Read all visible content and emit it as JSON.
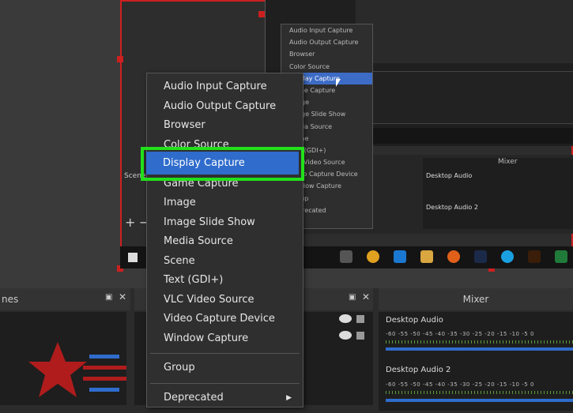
{
  "main_menu": {
    "items": [
      "Audio Input Capture",
      "Audio Output Capture",
      "Browser",
      "Color Source",
      "Display Capture",
      "Game Capture",
      "Image",
      "Image Slide Show",
      "Media Source",
      "Scene",
      "Text (GDI+)",
      "VLC Video Source",
      "Video Capture Device",
      "Window Capture"
    ],
    "group": "Group",
    "deprecated": "Deprecated"
  },
  "mini_menu": {
    "items": [
      "Audio Input Capture",
      "Audio Output Capture",
      "Browser",
      "Color Source",
      "Display Capture",
      "Game Capture",
      "Image",
      "Image Slide Show",
      "Media Source",
      "Scene",
      "Text (GDI+)",
      "VLC Video Source",
      "Video Capture Device",
      "Window Capture",
      "Group",
      "Deprecated"
    ]
  },
  "docks": {
    "scenes_title": "nes",
    "mixer_title": "Mixer",
    "scenes_label_small": "Scene"
  },
  "mixer": {
    "track1": "Desktop Audio",
    "track2": "Desktop Audio 2",
    "ticks": "-60  -55  -50  -45  -40  -35  -30  -25  -20  -15  -10  -5  0"
  },
  "colors": {
    "accent": "#2f6ccc",
    "highlight": "#22e01a",
    "canvas_border": "#cc2020"
  }
}
